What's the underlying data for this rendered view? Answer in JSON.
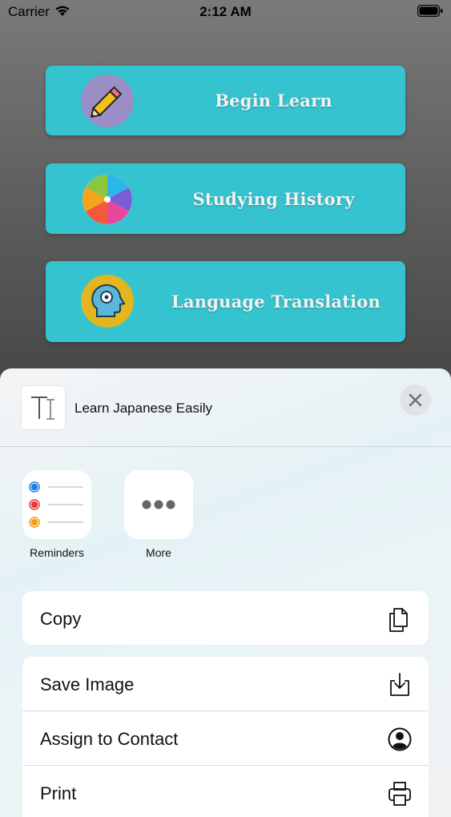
{
  "status_bar": {
    "carrier": "Carrier",
    "time": "2:12 AM"
  },
  "menu": {
    "buttons": [
      {
        "label": "Begin Learn",
        "icon": "pencil-icon"
      },
      {
        "label": "Studying History",
        "icon": "color-swirl-icon"
      },
      {
        "label": "Language Translation",
        "icon": "brain-gear-icon"
      }
    ],
    "accent": "#35c3cf"
  },
  "share_sheet": {
    "title": "Learn Japanese Easily",
    "apps": [
      {
        "label": "Reminders",
        "icon": "reminders-icon"
      },
      {
        "label": "More",
        "icon": "more-dots-icon"
      }
    ],
    "actions": [
      {
        "label": "Copy",
        "icon": "copy-icon"
      },
      {
        "label": "Save Image",
        "icon": "save-image-icon"
      },
      {
        "label": "Assign to Contact",
        "icon": "contact-icon"
      },
      {
        "label": "Print",
        "icon": "print-icon"
      }
    ]
  }
}
